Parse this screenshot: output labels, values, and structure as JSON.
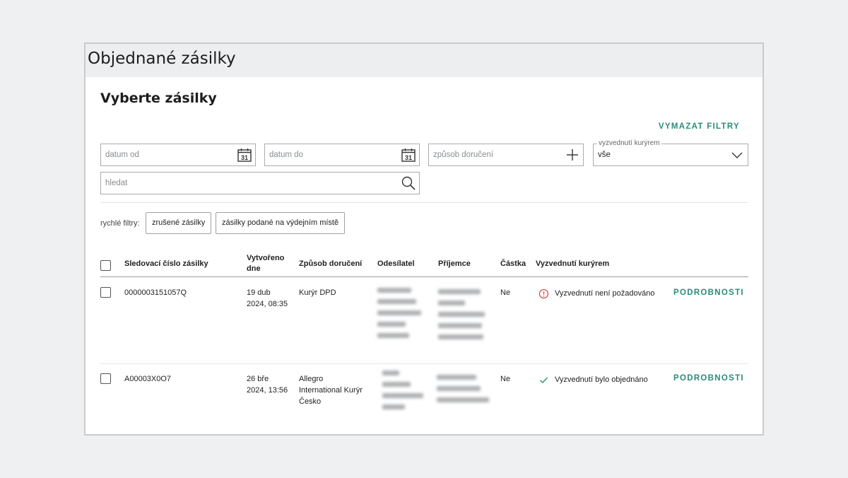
{
  "window": {
    "title": "Objednané zásilky"
  },
  "section": {
    "title": "Vyberte zásilky",
    "clear_filters": "VYMAZAT FILTRY"
  },
  "filters": {
    "date_from": {
      "placeholder": "datum od",
      "icon": "calendar-icon",
      "day": "31"
    },
    "date_to": {
      "placeholder": "datum do",
      "icon": "calendar-icon",
      "day": "31"
    },
    "delivery_method": {
      "placeholder": "způsob doručení",
      "icon": "plus-icon"
    },
    "courier_pickup": {
      "legend": "vyzvednutí kurýrem",
      "value": "vše",
      "icon": "chevron-down-icon"
    },
    "search": {
      "placeholder": "hledat",
      "icon": "search-icon"
    }
  },
  "quick_filters": {
    "label": "rychlé filtry:",
    "chips": [
      "zrušené zásilky",
      "zásilky podané na výdejním místě"
    ]
  },
  "table": {
    "headers": {
      "tracking": "Sledovací číslo zásilky",
      "created_1": "Vytvořeno",
      "created_2": "dne",
      "method": "Způsob doručení",
      "sender": "Odesílatel",
      "recipient": "Příjemce",
      "amount": "Částka",
      "pickup": "Vyzvednutí kurýrem"
    },
    "rows": [
      {
        "tracking": "0000003151057Q",
        "created_1": "19 dub",
        "created_2": "2024, 08:35",
        "method_1": "Kurýr DPD",
        "method_2": "",
        "method_3": "",
        "amount": "Ne",
        "pickup_status": "Vyzvednutí není požadováno",
        "pickup_icon": "warning-icon",
        "details": "PODROBNOSTI"
      },
      {
        "tracking": "A00003X0O7",
        "created_1": "26 bře",
        "created_2": "2024, 13:56",
        "method_1": "Allegro",
        "method_2": "International Kurýr",
        "method_3": "Česko",
        "amount": "Ne",
        "pickup_status": "Vyzvednutí bylo objednáno",
        "pickup_icon": "check-icon",
        "details": "PODROBNOSTI"
      }
    ]
  },
  "colors": {
    "accent": "#2a8c7a",
    "warning": "#d9534f",
    "success": "#2e9b5f"
  }
}
